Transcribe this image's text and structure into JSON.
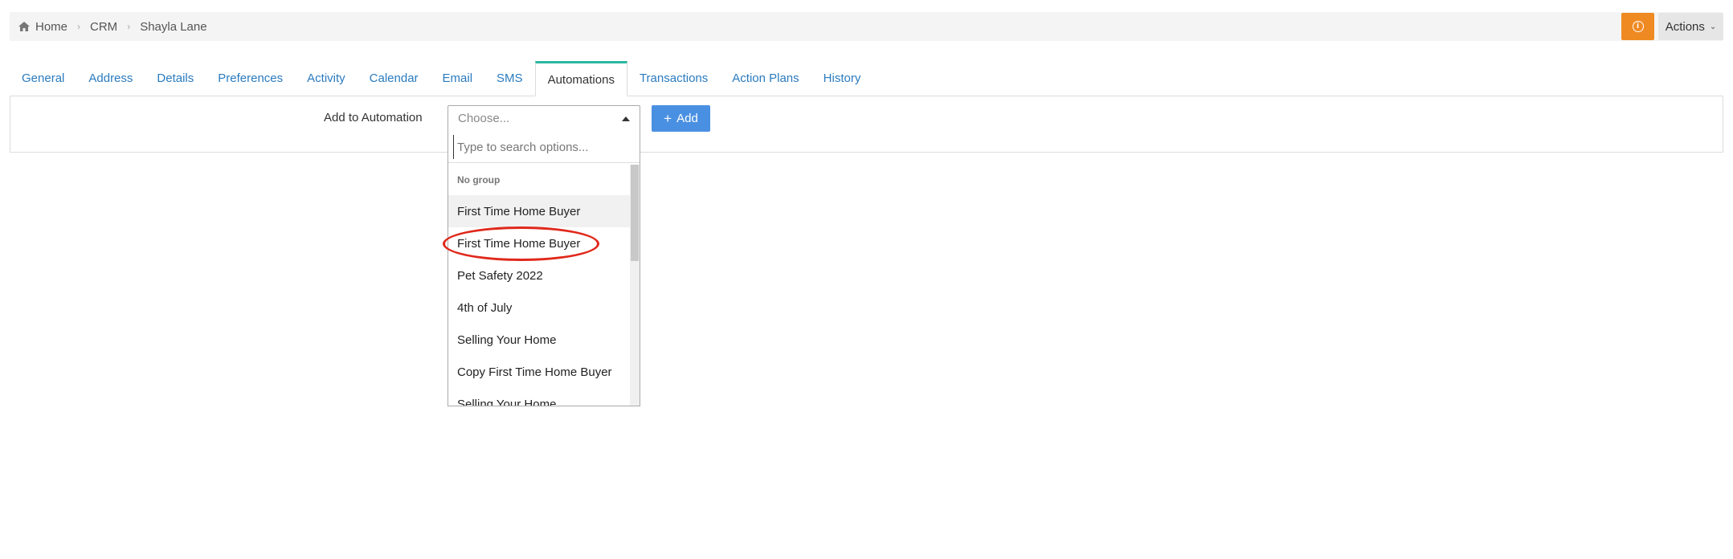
{
  "breadcrumb": {
    "home": "Home",
    "crm": "CRM",
    "contact": "Shayla Lane"
  },
  "header": {
    "actions_label": "Actions",
    "alert_glyph": "i"
  },
  "tabs": [
    {
      "label": "General"
    },
    {
      "label": "Address"
    },
    {
      "label": "Details"
    },
    {
      "label": "Preferences"
    },
    {
      "label": "Activity"
    },
    {
      "label": "Calendar"
    },
    {
      "label": "Email"
    },
    {
      "label": "SMS"
    },
    {
      "label": "Automations",
      "active": true
    },
    {
      "label": "Transactions"
    },
    {
      "label": "Action Plans"
    },
    {
      "label": "History"
    }
  ],
  "automation": {
    "field_label": "Add to Automation",
    "select_placeholder": "Choose...",
    "add_button_label": "Add",
    "search_placeholder": "Type to search options...",
    "group_label": "No group",
    "options": [
      "First Time Home Buyer",
      "First Time Home Buyer",
      "Pet Safety 2022",
      "4th of July",
      "Selling Your Home",
      "Copy First Time Home Buyer",
      "Selling Your Home"
    ]
  },
  "colors": {
    "accent_tab": "#2bb8a0",
    "link": "#2a7bbf",
    "primary_button": "#4a90e2",
    "alert_button": "#ef8a23",
    "annotation": "#e0281b"
  }
}
